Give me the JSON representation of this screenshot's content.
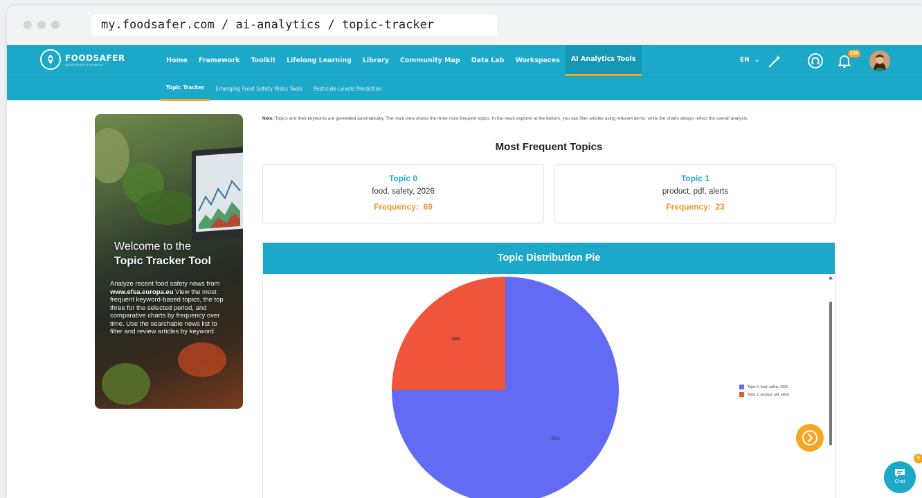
{
  "browser": {
    "url": "my.foodsafer.com / ai-analytics / topic-tracker"
  },
  "brand": {
    "name": "FOODSAFER",
    "tagline": "ACCELERATE'S SCIENCE"
  },
  "nav": {
    "items": [
      {
        "label": "Home"
      },
      {
        "label": "Framework"
      },
      {
        "label": "Toolkit"
      },
      {
        "label": "Lifelong Learning"
      },
      {
        "label": "Library"
      },
      {
        "label": "Community Map"
      },
      {
        "label": "Data Lab"
      },
      {
        "label": "Workspaces"
      },
      {
        "label": "AI Analytics Tools"
      }
    ],
    "language": "EN",
    "notifications_count": "104"
  },
  "subnav": {
    "items": [
      {
        "label": "Topic Tracker"
      },
      {
        "label": "Emerging Food Safety Risks Tools"
      },
      {
        "label": "Pesticide Levels Prediction"
      }
    ]
  },
  "hero": {
    "title_line1": "Welcome to the",
    "title_line2": "Topic Tracker Tool",
    "desc_before": "Analyze recent food safety news from ",
    "desc_link": "www.efsa.europa.eu",
    "desc_after": " View the most frequent keyword-based topics, the top three for the selected period, and comparative charts by frequency over time. Use the searchable news list to filter and review articles by keyword."
  },
  "note": {
    "label": "Note:",
    "text": " Topics and their keywords are generated automatically. The main view shows the three most frequent topics. In the news explorer at the bottom, you can filter articles using relevant terms, while the charts always reflect the overall analysis."
  },
  "most_frequent": {
    "title": "Most Frequent Topics",
    "freq_label": "Frequency:",
    "topics": [
      {
        "title": "Topic 0",
        "keywords": "food, safety, 2026",
        "frequency": "69"
      },
      {
        "title": "Topic 1",
        "keywords": "product, pdf, alerts",
        "frequency": "23"
      }
    ]
  },
  "pie": {
    "title": "Topic Distribution Pie",
    "slice_labels": [
      "75%",
      "25%"
    ]
  },
  "chart_data": {
    "type": "pie",
    "title": "Topic Distribution Pie",
    "categories": [
      "Topic 0: food, safety, 2026",
      "Topic 1: product, pdf, alerts"
    ],
    "values": [
      75,
      25
    ],
    "colors": [
      "#636bf5",
      "#ee553b"
    ],
    "legend": "right"
  },
  "chat": {
    "label": "Chat",
    "badge": "5"
  },
  "colors": {
    "primary": "#1ca8c9",
    "accent": "#f5a623",
    "frequency": "#f5922b"
  }
}
